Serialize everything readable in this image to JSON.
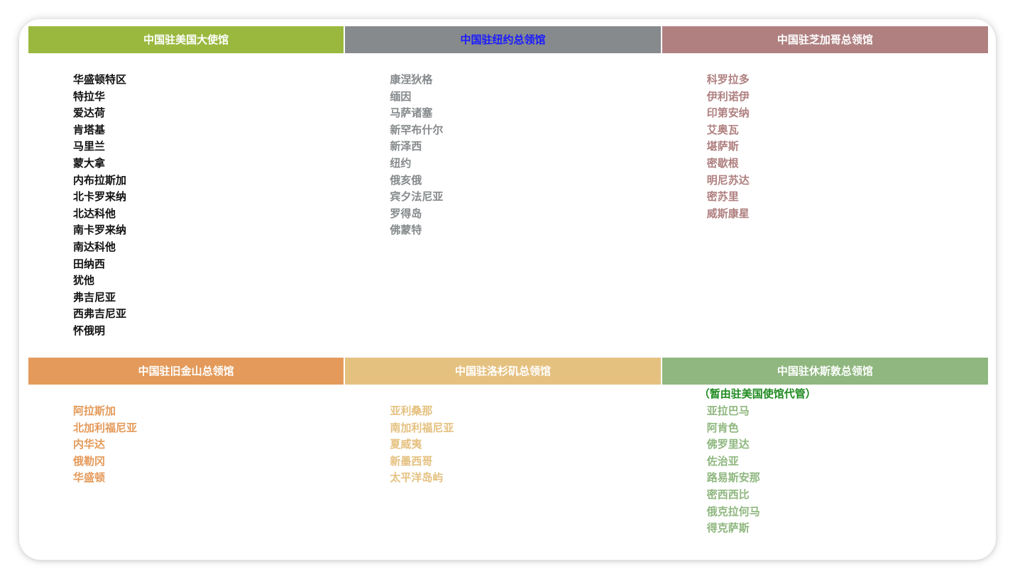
{
  "colors": {
    "dc": "#9ab83e",
    "ny": "#868a8c",
    "chicago": "#b08080",
    "sf": "#e49a5a",
    "la": "#e5c180",
    "houston": "#8fb77f",
    "ny_header_text": "#1a1aff",
    "note_text": "#1e8a1e"
  },
  "sections": [
    {
      "title": "中国驻美国大使馆",
      "states": [
        "华盛顿特区",
        "特拉华",
        "爱达荷",
        "肯塔基",
        "马里兰",
        "蒙大拿",
        "内布拉斯加",
        "北卡罗来纳",
        "北达科他",
        "南卡罗来纳",
        "南达科他",
        "田纳西",
        "犹他",
        "弗吉尼亚",
        "西弗吉尼亚",
        "怀俄明"
      ]
    },
    {
      "title": "中国驻纽约总领馆",
      "states": [
        "康涅狄格",
        "缅因",
        "马萨诸塞",
        "新罕布什尔",
        "新泽西",
        "纽约",
        "俄亥俄",
        "宾夕法尼亚",
        "罗得岛",
        "佛蒙特"
      ]
    },
    {
      "title": "中国驻芝加哥总领馆",
      "states": [
        "科罗拉多",
        "伊利诺伊",
        "印第安纳",
        "艾奥瓦",
        "堪萨斯",
        "密歇根",
        "明尼苏达",
        "密苏里",
        "威斯康星"
      ]
    },
    {
      "title": "中国驻旧金山总领馆",
      "states": [
        "阿拉斯加",
        "北加利福尼亚",
        "内华达",
        "俄勒冈",
        "华盛顿"
      ]
    },
    {
      "title": "中国驻洛杉矶总领馆",
      "states": [
        "亚利桑那",
        "南加利福尼亚",
        "夏威夷",
        "新墨西哥",
        "太平洋岛屿"
      ]
    },
    {
      "title": "中国驻休斯敦总领馆",
      "note": "（暂由驻美国使馆代管）",
      "states": [
        "亚拉巴马",
        "阿肯色",
        "佛罗里达",
        "佐治亚",
        "路易斯安那",
        "密西西比",
        "俄克拉何马",
        "得克萨斯"
      ]
    }
  ]
}
